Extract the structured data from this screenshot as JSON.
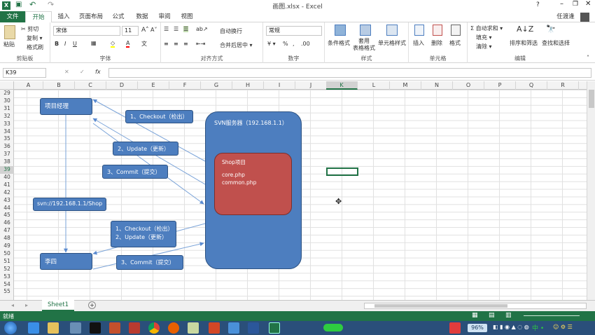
{
  "window": {
    "title": "画图.xlsx - Excel",
    "user": "任渡逢"
  },
  "tabs": [
    "文件",
    "开始",
    "插入",
    "页面布局",
    "公式",
    "数据",
    "审阅",
    "视图"
  ],
  "ribbon": {
    "clipboard": {
      "label": "剪贴板",
      "paste": "粘贴",
      "cut": "✂ 剪切",
      "copy": "复制 ▾",
      "format_painter": "格式刷"
    },
    "font": {
      "label": "字体",
      "font_name": "宋体",
      "font_size": "11"
    },
    "align": {
      "label": "对齐方式",
      "wrap": "自动换行",
      "merge": "合并后居中 ▾"
    },
    "number": {
      "label": "数字",
      "format": "常规"
    },
    "styles": {
      "label": "样式",
      "cond": "条件格式",
      "table": "套用\n表格格式",
      "cell": "单元格样式"
    },
    "cells": {
      "label": "单元格",
      "insert": "插入",
      "delete": "删除",
      "format": "格式"
    },
    "edit": {
      "label": "编辑",
      "autosum": "Σ 自动求和 ▾",
      "fill": "填充 ▾",
      "clear": "清除 ▾",
      "sort": "排序和筛选",
      "find": "查找和选择"
    }
  },
  "formula_bar": {
    "name_box": "K39",
    "fx": "fx",
    "value": ""
  },
  "columns": [
    "A",
    "B",
    "C",
    "D",
    "E",
    "F",
    "G",
    "H",
    "I",
    "J",
    "K",
    "L",
    "M",
    "N",
    "O",
    "P",
    "Q",
    "R"
  ],
  "selected_column": "K",
  "rows": [
    "29",
    "30",
    "31",
    "32",
    "33",
    "34",
    "35",
    "36",
    "37",
    "38",
    "39",
    "40",
    "41",
    "42",
    "43",
    "44",
    "45",
    "46",
    "47",
    "48",
    "49",
    "50",
    "51",
    "52",
    "53",
    "54",
    "55"
  ],
  "selected_row": "39",
  "diagram": {
    "pm": "项目经理",
    "lisi": "李四",
    "svn_url": "svn://192.168.1.1/Shop",
    "server_title": "SVN服务器（192.168.1.1）",
    "shop_title": "Shop项目",
    "shop_file1": "core.php",
    "shop_file2": "common.php",
    "step1": "1、Checkout（检出）",
    "step2": "2、Update（更新）",
    "step3": "3、Commit（提交）",
    "step4a": "1、Checkout（检出）",
    "step4b": "2、Update（更新）",
    "step5": "3、Commit（提交）"
  },
  "sheet": {
    "name": "Sheet1",
    "add": "+"
  },
  "status": {
    "mode": "就绪",
    "zoom": "96%"
  },
  "colors": {
    "excel_green": "#217346",
    "box_blue": "#4d7ebf",
    "shop_red": "#c0504d"
  }
}
